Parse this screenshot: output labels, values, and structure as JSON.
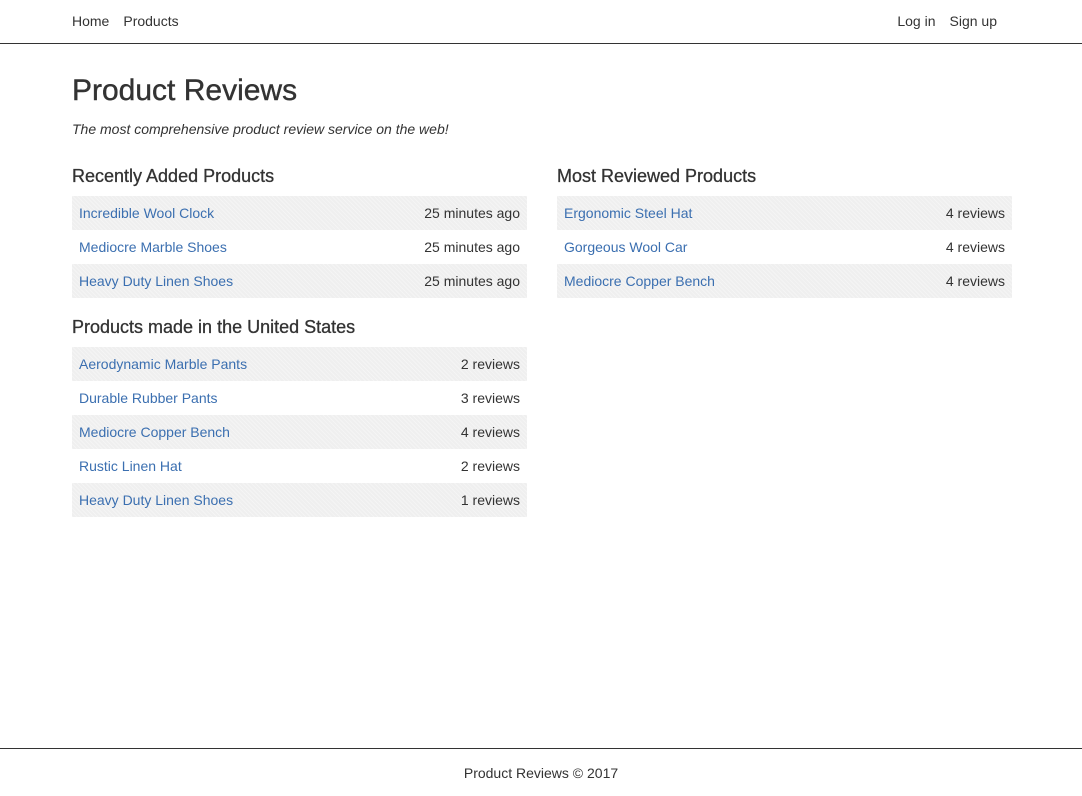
{
  "nav": {
    "left": [
      "Home",
      "Products"
    ],
    "right": [
      "Log in",
      "Sign up"
    ]
  },
  "header": {
    "title": "Product Reviews",
    "tagline": "The most comprehensive product review service on the web!"
  },
  "recently_added": {
    "title": "Recently Added Products",
    "items": [
      {
        "name": "Incredible Wool Clock",
        "meta": "25 minutes ago"
      },
      {
        "name": "Mediocre Marble Shoes",
        "meta": "25 minutes ago"
      },
      {
        "name": "Heavy Duty Linen Shoes",
        "meta": "25 minutes ago"
      }
    ]
  },
  "most_reviewed": {
    "title": "Most Reviewed Products",
    "items": [
      {
        "name": "Ergonomic Steel Hat",
        "meta": "4 reviews"
      },
      {
        "name": "Gorgeous Wool Car",
        "meta": "4 reviews"
      },
      {
        "name": "Mediocre Copper Bench",
        "meta": "4 reviews"
      }
    ]
  },
  "made_in_us": {
    "title": "Products made in the United States",
    "items": [
      {
        "name": "Aerodynamic Marble Pants",
        "meta": "2 reviews"
      },
      {
        "name": "Durable Rubber Pants",
        "meta": "3 reviews"
      },
      {
        "name": "Mediocre Copper Bench",
        "meta": "4 reviews"
      },
      {
        "name": "Rustic Linen Hat",
        "meta": "2 reviews"
      },
      {
        "name": "Heavy Duty Linen Shoes",
        "meta": "1 reviews"
      }
    ]
  },
  "footer": {
    "text": "Product Reviews © 2017"
  },
  "colors": {
    "link": "#3b6fb0",
    "text": "#333333",
    "stripe": "#efefef"
  }
}
